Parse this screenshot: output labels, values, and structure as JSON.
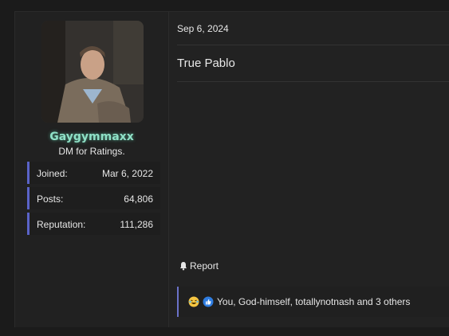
{
  "post": {
    "user": {
      "username": "Gaygymmaxx",
      "title": "DM for Ratings.",
      "stats": [
        {
          "label": "Joined:",
          "value": "Mar 6, 2022"
        },
        {
          "label": "Posts:",
          "value": "64,806"
        },
        {
          "label": "Reputation:",
          "value": "111,286"
        }
      ]
    },
    "date": "Sep 6, 2024",
    "message": "True Pablo",
    "report_label": "Report",
    "reactions_text": "You, God-himself, totallynotnash and 3 others"
  },
  "colors": {
    "username": "#8fe0c6",
    "stat_border": "#5a63c8",
    "reaction_border": "#6b72c9"
  },
  "icons": [
    "bell-icon",
    "crying-laughing-emoji-icon",
    "thumbs-up-icon"
  ]
}
